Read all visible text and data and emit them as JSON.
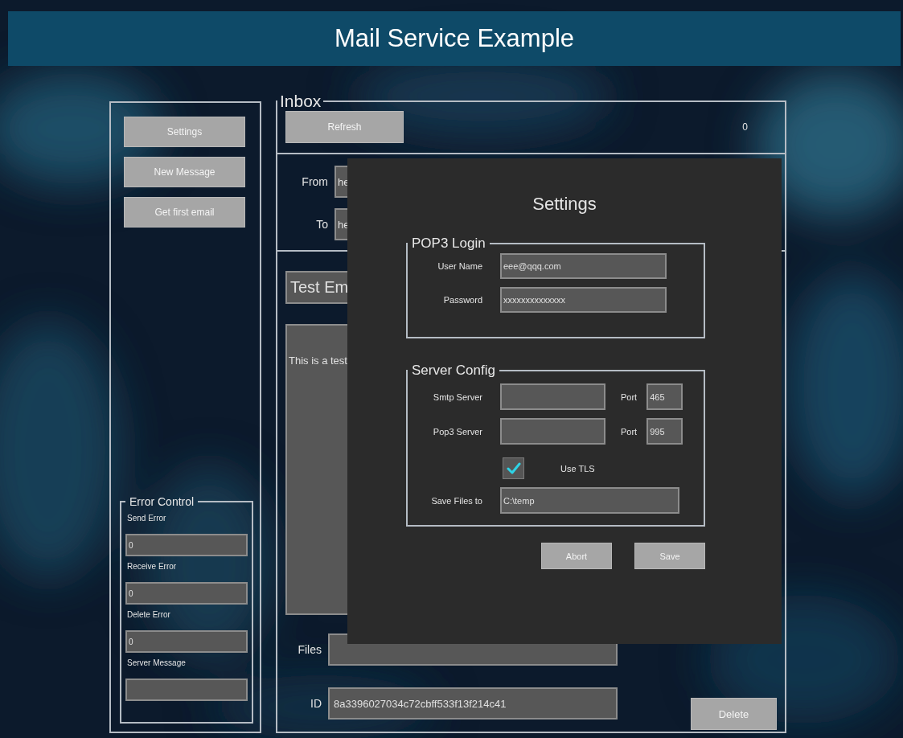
{
  "window": {
    "title": "Mail Service Example"
  },
  "sidebar": {
    "buttons": [
      "Settings",
      "New Message",
      "Get first email"
    ],
    "error_control": {
      "title": "Error Control",
      "fields": [
        {
          "label": "Send Error",
          "value": "0"
        },
        {
          "label": "Receive Error",
          "value": "0"
        },
        {
          "label": "Delete Error",
          "value": "0"
        },
        {
          "label": "Server Message"
        }
      ]
    }
  },
  "inbox": {
    "title": "Inbox",
    "refresh_button": "Refresh",
    "count": "0",
    "from": {
      "label": "From",
      "value": "he"
    },
    "to": {
      "label": "To",
      "value": "he"
    },
    "subject": "Test Em",
    "body": "This is a test",
    "files": {
      "label": "Files"
    },
    "id": {
      "label": "ID",
      "value": "8a3396027034c72cbff533f13f214c41"
    },
    "delete_button": "Delete"
  },
  "settings_dialog": {
    "title": "Settings",
    "pop3_login": {
      "title": "POP3 Login",
      "user_name": {
        "label": "User Name",
        "value": "eee@qqq.com"
      },
      "password": {
        "label": "Password",
        "value": "xxxxxxxxxxxxxx"
      }
    },
    "server_config": {
      "title": "Server Config",
      "smtp": {
        "label": "Smtp Server",
        "port_label": "Port",
        "port": "465"
      },
      "pop3": {
        "label": "Pop3 Server",
        "port_label": "Port",
        "port": "995"
      },
      "use_tls": {
        "label": "Use TLS",
        "checked": true
      },
      "save_files": {
        "label": "Save Files to",
        "value": "C:\\temp"
      }
    },
    "buttons": [
      "Abort",
      "Save"
    ]
  }
}
